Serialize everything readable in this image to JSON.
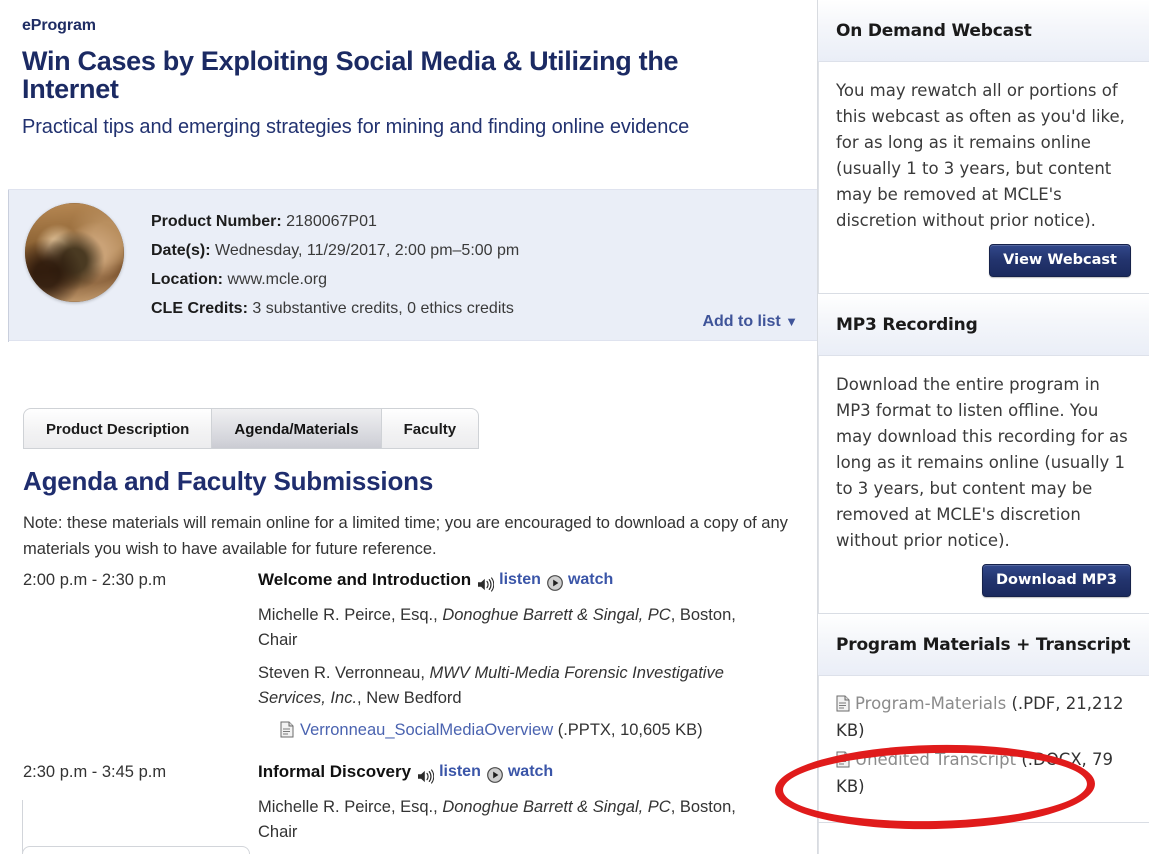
{
  "header": {
    "kicker": "eProgram",
    "title": "Win Cases by Exploiting Social Media & Utilizing the Internet",
    "subtitle": "Practical tips and emerging strategies for mining and finding online evidence"
  },
  "info": {
    "product_number_label": "Product Number:",
    "product_number_value": "2180067P01",
    "dates_label": "Date(s):",
    "dates_value": "Wednesday, 11/29/2017, 2:00 pm–5:00 pm",
    "location_label": "Location:",
    "location_value": "www.mcle.org",
    "credits_label": "CLE Credits:",
    "credits_value": "3 substantive credits, 0 ethics credits",
    "add_to_list": "Add to list",
    "add_to_list_caret": "▼",
    "thumbnail_alt": "seminar-photo"
  },
  "tabs": [
    {
      "label": "Product Description",
      "active": false
    },
    {
      "label": "Agenda/Materials",
      "active": true
    },
    {
      "label": "Faculty",
      "active": false
    }
  ],
  "content": {
    "section_heading": "Agenda and Faculty Submissions",
    "note": "Note: these materials will remain online for a limited time; you are encouraged to download a copy of any materials you wish to have available for future reference."
  },
  "agenda": [
    {
      "time": "2:00 p.m - 2:30 p.m",
      "title": "Welcome and Introduction",
      "listen_label": "listen",
      "watch_label": "watch",
      "people": [
        {
          "name": "Michelle R. Peirce, Esq., ",
          "org": "Donoghue Barrett & Singal, PC",
          "tail": ", Boston, Chair"
        },
        {
          "name": "Steven R. Verronneau, ",
          "org": "MWV Multi-Media Forensic Investigative Services, Inc.",
          "tail": ", New Bedford"
        }
      ],
      "files": [
        {
          "name": "Verronneau_SocialMediaOverview",
          "meta": " (.PPTX, 10,605 KB)"
        }
      ]
    },
    {
      "time": "2:30 p.m - 3:45 p.m",
      "title": "Informal Discovery",
      "listen_label": "listen",
      "watch_label": "watch",
      "people": [
        {
          "name": "Michelle R. Peirce, Esq., ",
          "org": "Donoghue Barrett & Singal, PC",
          "tail": ", Boston, Chair"
        }
      ],
      "files": []
    }
  ],
  "sidebar": {
    "panels": [
      {
        "title": "On Demand Webcast",
        "text": "You may rewatch all or portions of this webcast as often as you'd like, for as long as it remains online (usually 1 to 3 years, but content may be removed at MCLE's discretion without prior notice).",
        "button": "View Webcast"
      },
      {
        "title": "MP3 Recording",
        "text": "Download the entire program in MP3 format to listen offline. You may download this recording for as long as it remains online (usually 1 to 3 years, but content may be removed at MCLE's discretion without prior notice).",
        "button": "Download MP3"
      }
    ],
    "materials_panel": {
      "title": "Program Materials + Transcript",
      "files": [
        {
          "name": "Program-Materials",
          "meta": " (.PDF, 21,212 KB)"
        },
        {
          "name": "Unedited Transcript",
          "meta": " (.DOCX, 79 KB)"
        }
      ]
    }
  },
  "annotation": {
    "shape": "ellipse",
    "color": "#e01b1b",
    "targets": "unedited-transcript-file"
  },
  "colors": {
    "title_blue": "#1b2a63",
    "link_blue": "#3a55a8",
    "info_bg": "#eaeef7",
    "button_navy": "#23346e",
    "annotation_red": "#e01b1b"
  }
}
